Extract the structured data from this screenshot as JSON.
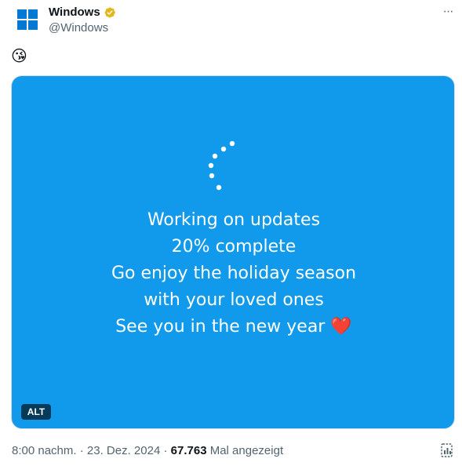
{
  "account": {
    "display_name": "Windows",
    "handle": "@Windows",
    "avatar_icon": "windows-logo-icon",
    "verified_icon": "verified-badge-icon",
    "verified_color": "#e2b719"
  },
  "menu": {
    "more_label": "···"
  },
  "tweet": {
    "text": "😘"
  },
  "media": {
    "background_color": "#119aeb",
    "lines": [
      "Working on updates",
      "20% complete",
      "Go enjoy the holiday season",
      "with your loved ones",
      "See you in the new year"
    ],
    "heart": "❤️",
    "alt_badge": "ALT",
    "loading_icon": "loading-spinner-icon"
  },
  "meta": {
    "time": "8:00 nachm.",
    "separator": " · ",
    "date": "23. Dez. 2024",
    "views_count": "67.763",
    "views_label": " Mal angezeigt"
  },
  "actions": {
    "analytics_icon": "analytics-icon"
  }
}
